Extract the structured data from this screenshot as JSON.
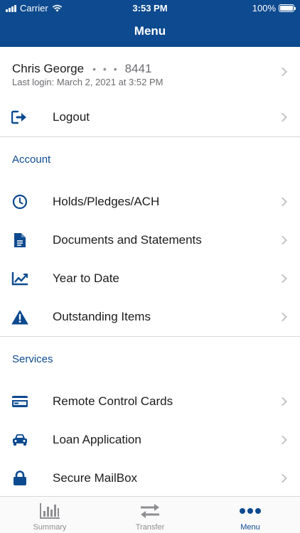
{
  "status_bar": {
    "carrier": "Carrier",
    "time": "3:53 PM",
    "battery": "100%"
  },
  "nav": {
    "title": "Menu"
  },
  "user": {
    "name": "Chris George",
    "masked": "• • •",
    "account": "8441",
    "last_login": "Last login: March 2, 2021 at 3:52 PM"
  },
  "logout": {
    "label": "Logout",
    "icon": "logout-icon"
  },
  "sections": {
    "account": {
      "title": "Account",
      "items": [
        {
          "label": "Holds/Pledges/ACH",
          "icon": "clock-icon"
        },
        {
          "label": "Documents and Statements",
          "icon": "document-icon"
        },
        {
          "label": "Year to Date",
          "icon": "chart-icon"
        },
        {
          "label": "Outstanding Items",
          "icon": "warning-icon"
        }
      ]
    },
    "services": {
      "title": "Services",
      "items": [
        {
          "label": "Remote Control Cards",
          "icon": "credit-card-icon"
        },
        {
          "label": "Loan Application",
          "icon": "car-icon"
        },
        {
          "label": "Secure MailBox",
          "icon": "lock-icon"
        }
      ]
    }
  },
  "tabbar": {
    "tabs": [
      {
        "label": "Summary",
        "icon": "bar-chart-icon"
      },
      {
        "label": "Transfer",
        "icon": "transfer-arrows-icon"
      },
      {
        "label": "Menu",
        "icon": "more-dots-icon"
      }
    ],
    "active": "Menu"
  },
  "colors": {
    "brand": "#0d4a8f",
    "chevron": "#c4c4c8",
    "muted": "#8e8e93"
  }
}
